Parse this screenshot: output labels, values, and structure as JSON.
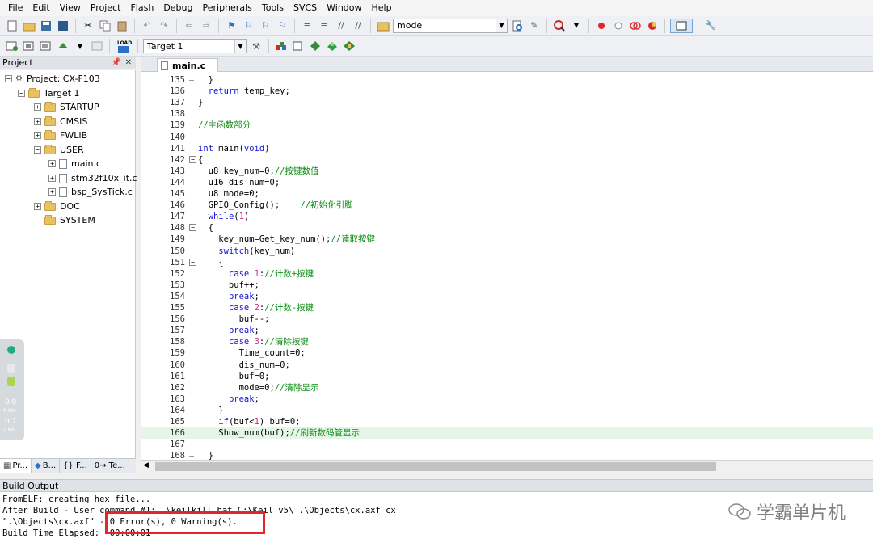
{
  "menu": [
    "File",
    "Edit",
    "View",
    "Project",
    "Flash",
    "Debug",
    "Peripherals",
    "Tools",
    "SVCS",
    "Window",
    "Help"
  ],
  "toolbar": {
    "find_combo": "mode",
    "target_combo": "Target 1"
  },
  "project_panel": {
    "title": "Project",
    "tree": {
      "project": "Project: CX-F103",
      "target": "Target 1",
      "groups": [
        "STARTUP",
        "CMSIS",
        "FWLIB",
        "USER"
      ],
      "user_files": [
        "main.c",
        "stm32f10x_it.c",
        "bsp_SysTick.c"
      ],
      "more_groups": [
        "DOC",
        "SYSTEM"
      ]
    },
    "tabs": [
      "Pr...",
      "B...",
      "{} F...",
      "0→ Te..."
    ]
  },
  "side_widget": {
    "up_value": "0.0",
    "up_unit": "K/s",
    "down_value": "0.7",
    "down_unit": "K/s"
  },
  "editor": {
    "tab": "main.c",
    "lines": [
      {
        "n": "135",
        "t": "  }"
      },
      {
        "n": "136",
        "t": "  return temp_key;"
      },
      {
        "n": "137",
        "t": "}"
      },
      {
        "n": "138",
        "t": ""
      },
      {
        "n": "139",
        "t": "//主函数部分"
      },
      {
        "n": "140",
        "t": ""
      },
      {
        "n": "141",
        "t": "int main(void)"
      },
      {
        "n": "142",
        "t": "{"
      },
      {
        "n": "143",
        "t": "  u8 key_num=0;//按键数值"
      },
      {
        "n": "144",
        "t": "  u16 dis_num=0;"
      },
      {
        "n": "145",
        "t": "  u8 mode=0;"
      },
      {
        "n": "146",
        "t": "  GPIO_Config();    //初始化引脚"
      },
      {
        "n": "147",
        "t": "  while(1)"
      },
      {
        "n": "148",
        "t": "  {"
      },
      {
        "n": "149",
        "t": "    key_num=Get_key_num();//读取按键"
      },
      {
        "n": "150",
        "t": "    switch(key_num)"
      },
      {
        "n": "151",
        "t": "    {"
      },
      {
        "n": "152",
        "t": "      case 1://计数+按键"
      },
      {
        "n": "153",
        "t": "      buf++;"
      },
      {
        "n": "154",
        "t": "      break;"
      },
      {
        "n": "155",
        "t": "      case 2://计数-按键"
      },
      {
        "n": "156",
        "t": "        buf--;"
      },
      {
        "n": "157",
        "t": "      break;"
      },
      {
        "n": "158",
        "t": "      case 3://清除按键"
      },
      {
        "n": "159",
        "t": "        Time_count=0;"
      },
      {
        "n": "160",
        "t": "        dis_num=0;"
      },
      {
        "n": "161",
        "t": "        buf=0;"
      },
      {
        "n": "162",
        "t": "        mode=0;//清除显示"
      },
      {
        "n": "163",
        "t": "      break;"
      },
      {
        "n": "164",
        "t": "    }"
      },
      {
        "n": "165",
        "t": "    if(buf<1) buf=0;"
      },
      {
        "n": "166",
        "t": "    Show_num(buf);//刷新数码管显示"
      },
      {
        "n": "167",
        "t": ""
      },
      {
        "n": "168",
        "t": "  }"
      }
    ]
  },
  "build_output": {
    "title": "Build Output",
    "lines": [
      "FromELF: creating hex file...",
      "After Build - User command #1: .\\keilkill.bat C:\\Keil_v5\\ .\\Objects\\cx.axf cx",
      "\".\\Objects\\cx.axf\" - 0 Error(s), 0 Warning(s).",
      "Build Time Elapsed:  00:00:01"
    ]
  },
  "watermark": "学霸单片机",
  "colors": {
    "keyword": "#1212d6",
    "comment": "#0a8a12",
    "number": "#d6258b",
    "highlight_line": "#e5f6e8",
    "annotation_box": "#e4262b"
  }
}
